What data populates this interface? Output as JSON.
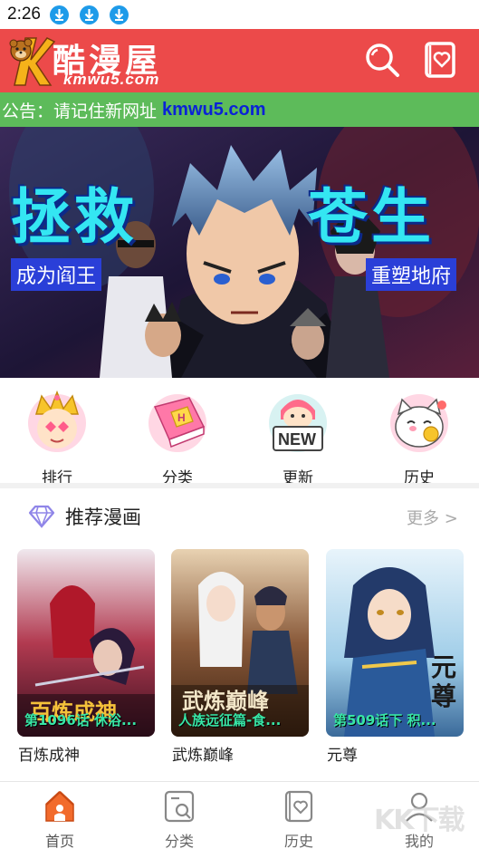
{
  "status_bar": {
    "time": "2:26",
    "icons": [
      "download-icon",
      "download-icon",
      "download-icon"
    ]
  },
  "header": {
    "title": "酷漫屋",
    "domain": "kmwu5.com",
    "icons": [
      "search-icon",
      "favorites-icon"
    ],
    "brand_color": "#ec4a4a"
  },
  "notice": {
    "label": "公告：请记住新网址",
    "link": "kmwu5.com",
    "bg_color": "#5dbb5a"
  },
  "banner": {
    "title_left": "拯救",
    "title_right": "苍生",
    "sub_left": "成为阎王",
    "sub_right": "重塑地府"
  },
  "categories": [
    {
      "label": "排行",
      "icon": "crown-icon"
    },
    {
      "label": "分类",
      "icon": "book-icon"
    },
    {
      "label": "更新",
      "icon": "new-icon"
    },
    {
      "label": "历史",
      "icon": "lucky-cat-icon"
    }
  ],
  "recommend": {
    "title": "推荐漫画",
    "more": "更多 >",
    "comics": [
      {
        "name": "百炼成神",
        "chapter": "第1096话 休浴..."
      },
      {
        "name": "武炼巅峰",
        "chapter": "人族远征篇-食..."
      },
      {
        "name": "元尊",
        "chapter": "第509话下 积..."
      }
    ]
  },
  "tab_bar": {
    "tabs": [
      {
        "label": "首页",
        "icon": "home-icon",
        "active": true
      },
      {
        "label": "分类",
        "icon": "category-icon",
        "active": false
      },
      {
        "label": "历史",
        "icon": "history-icon",
        "active": false
      },
      {
        "label": "我的",
        "icon": "profile-icon",
        "active": false
      }
    ],
    "active_color": "#f26b2c"
  },
  "watermark": "KK下载"
}
